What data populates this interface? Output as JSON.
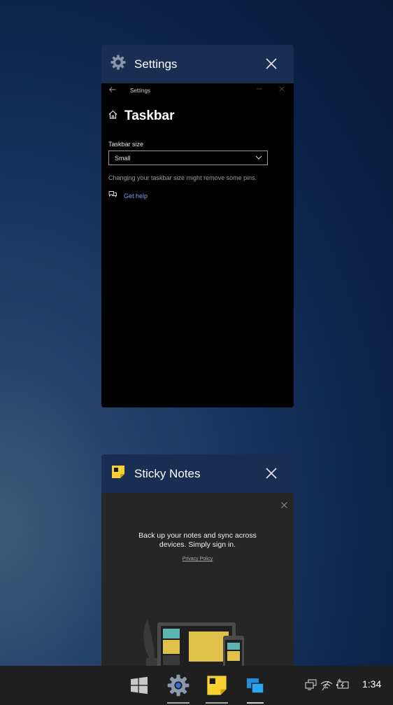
{
  "task_view": {
    "settings_card": {
      "app_title": "Settings",
      "app_icon": "gear-icon",
      "window": {
        "titlebar_text": "Settings",
        "page_heading": "Taskbar",
        "taskbar_size_label": "Taskbar size",
        "taskbar_size_value": "Small",
        "hint": "Changing your taskbar size might remove some pins.",
        "help_link": "Get help"
      }
    },
    "sticky_card": {
      "app_title": "Sticky Notes",
      "app_icon": "sticky-notes-icon",
      "window": {
        "message_line1": "Back up your notes and sync across",
        "message_line2": "devices. Simply sign in.",
        "privacy_link": "Privacy Policy"
      }
    }
  },
  "taskbar": {
    "pinned": [
      {
        "name": "start-button",
        "icon": "windows-logo-icon"
      },
      {
        "name": "settings-taskbar-button",
        "icon": "gear-icon"
      },
      {
        "name": "sticky-notes-taskbar-button",
        "icon": "sticky-notes-icon"
      },
      {
        "name": "task-view-button",
        "icon": "task-view-icon"
      }
    ],
    "tray": [
      "network-device-icon",
      "wifi-icon",
      "battery-charging-icon"
    ],
    "clock": "1:34"
  },
  "colors": {
    "card_header": "#1a2d52",
    "link_blue": "#7aa3e8",
    "sticky_yellow": "#f8d030",
    "taskbar_bg": "#1f1f1f"
  }
}
